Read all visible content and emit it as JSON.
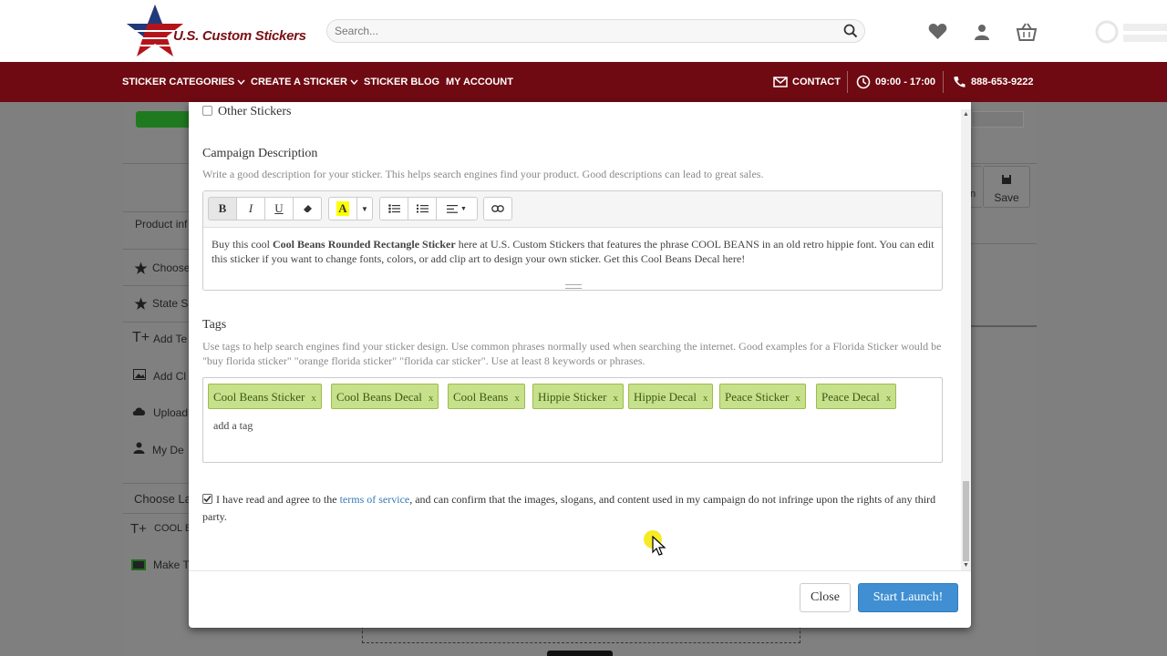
{
  "header": {
    "logo_text": "U.S. Custom Stickers",
    "search_placeholder": "Search..."
  },
  "nav": {
    "sticker_categories": "STICKER CATEGORIES",
    "create_a_sticker": "CREATE A STICKER",
    "sticker_blog": "STICKER BLOG",
    "my_account": "MY ACCOUNT",
    "contact": "CONTACT",
    "hours": "09:00 - 17:00",
    "phone": "888-653-9222"
  },
  "background": {
    "save_label": "Save",
    "product_info": "Product inf",
    "choose": "Choose",
    "state": "State S",
    "add_text": "Add Te",
    "add_clipart": "Add Cl",
    "upload": "Upload",
    "my_designs": "My De",
    "choose_layer": "Choose La",
    "layer_text": "COOL B",
    "make": "Make T"
  },
  "modal": {
    "other_stickers": "Other Stickers",
    "campaign_description_title": "Campaign Description",
    "campaign_description_help": "Write a good description for your sticker. This helps search engines find your product. Good descriptions can lead to great sales.",
    "description_prefix": "Buy this cool ",
    "description_bold": "Cool Beans Rounded Rectangle Sticker",
    "description_suffix": " here at U.S. Custom Stickers that features the phrase COOL BEANS in an old retro hippie font. You can edit this sticker if you want to change fonts, colors, or add clip art to design your own sticker. Get this Cool Beans Decal here!",
    "tags_title": "Tags",
    "tags_help": "Use tags to help search engines find your sticker design. Use common phrases normally used when searching the internet. Good examples for a Florida Sticker would be \"buy florida sticker\" \"orange florida sticker\" \"florida car sticker\". Use at least 8 keywords or phrases.",
    "tags": [
      "Cool Beans Sticker",
      "Cool Beans Decal",
      "Cool Beans",
      "Hippie Sticker",
      "Hippie Decal",
      "Peace Sticker",
      "Peace Decal"
    ],
    "tag_remove": "x",
    "add_tag_placeholder": "add a tag",
    "agree_prefix": "I have read and agree to the ",
    "terms_link": "terms of service",
    "agree_suffix": ", and can confirm that the images, slogans, and content used in my campaign do not infringe upon the rights of any third party.",
    "agree_checked": true,
    "close_button": "Close",
    "start_button": "Start Launch!"
  },
  "colors": {
    "nav_bg": "#6f0a12",
    "tag_bg": "#c7e08c",
    "primary_button": "#3f8fd2",
    "link": "#337ab7"
  }
}
